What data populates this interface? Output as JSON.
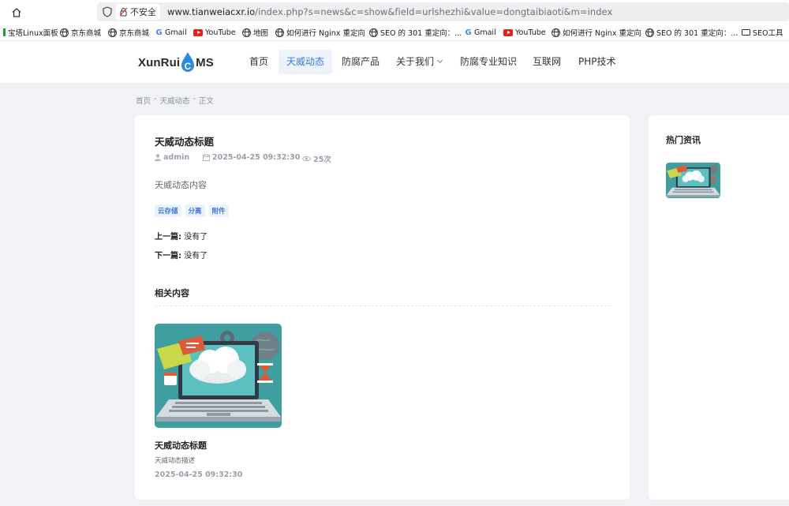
{
  "browser": {
    "insecure_label": "不安全",
    "url_domain": "www.tianweiacxr.io",
    "url_rest": "/index.php?s=news&c=show&field=urlshezhi&value=dongtaibiaoti&m=index",
    "bookmarks": [
      {
        "label": "宝塔Linux面板",
        "icon": "baota-icon"
      },
      {
        "label": "京东商城",
        "icon": "globe-icon"
      },
      {
        "label": "京东商城",
        "icon": "globe-icon"
      },
      {
        "label": "Gmail",
        "icon": "google-icon"
      },
      {
        "label": "YouTube",
        "icon": "youtube-icon"
      },
      {
        "label": "地图",
        "icon": "globe-icon"
      },
      {
        "label": "如何进行 Nginx 重定向",
        "icon": "globe-icon"
      },
      {
        "label": "SEO 的 301 重定向：...",
        "icon": "globe-icon"
      },
      {
        "label": "Gmail",
        "icon": "google-icon"
      },
      {
        "label": "YouTube",
        "icon": "youtube-icon"
      },
      {
        "label": "如何进行 Nginx 重定向",
        "icon": "globe-icon"
      },
      {
        "label": "SEO 的 301 重定向：...",
        "icon": "globe-icon"
      },
      {
        "label": "SEO工具",
        "icon": "folder-icon"
      }
    ]
  },
  "site": {
    "logo_left": "XunRui",
    "logo_drop_letter": "C",
    "logo_right": "MS",
    "nav": [
      {
        "label": "首页"
      },
      {
        "label": "天威动态",
        "active": true
      },
      {
        "label": "防腐产品"
      },
      {
        "label": "关于我们"
      },
      {
        "label": "防腐专业知识"
      },
      {
        "label": "互联网"
      },
      {
        "label": "PHP技术"
      }
    ]
  },
  "breadcrumb": {
    "home": "首页",
    "sep": "-",
    "category": "天威动态",
    "current": "正文"
  },
  "article": {
    "title": "天威动态标题",
    "author": "admin",
    "date": "2025-04-25 09:32:30",
    "views": "25次",
    "content": "天威动态内容",
    "tags": [
      "云存储",
      "分离",
      "附件"
    ],
    "prev_label": "上一篇:",
    "prev_value": "没有了",
    "next_label": "下一篇:",
    "next_value": "没有了"
  },
  "related": {
    "heading": "相关内容",
    "items": [
      {
        "title": "天威动态标题",
        "desc": "天威动态描述",
        "date": "2025-04-25 09:32:30"
      }
    ]
  },
  "sidebar": {
    "hot_heading": "热门资讯"
  },
  "colors": {
    "accent": "#3a7bd5",
    "page_bg": "#f0f2f5",
    "thumb_bg": "#3f9ea0"
  }
}
